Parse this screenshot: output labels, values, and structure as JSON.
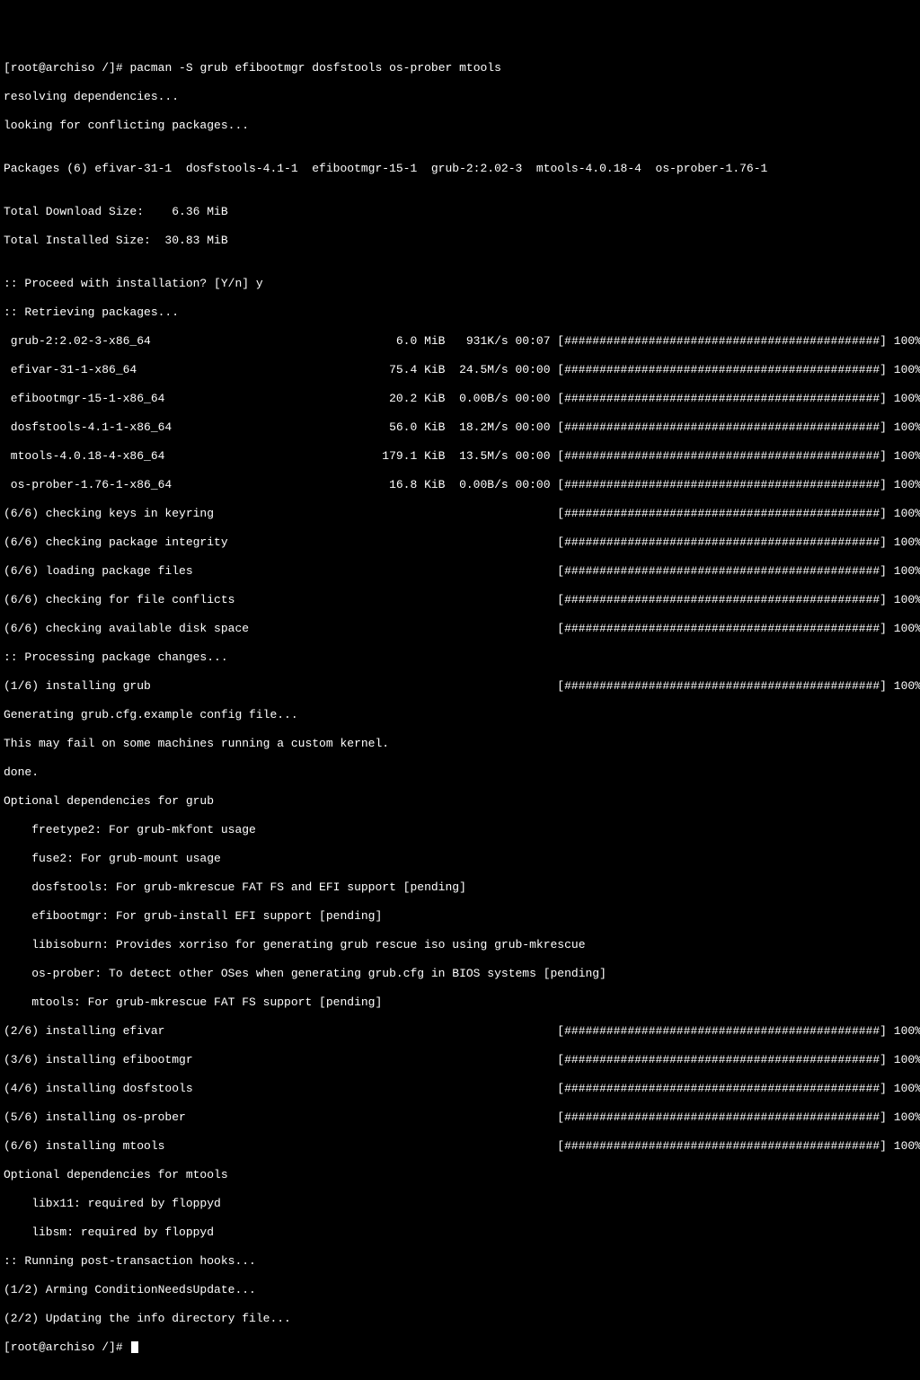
{
  "prompt": "[root@archiso /]# ",
  "command": "pacman -S grub efibootmgr dosfstools os-prober mtools",
  "lines": {
    "l1": "resolving dependencies...",
    "l2": "looking for conflicting packages...",
    "l3": "",
    "l4": "Packages (6) efivar-31-1  dosfstools-4.1-1  efibootmgr-15-1  grub-2:2.02-3  mtools-4.0.18-4  os-prober-1.76-1",
    "l5": "",
    "l6": "Total Download Size:    6.36 MiB",
    "l7": "Total Installed Size:  30.83 MiB",
    "l8": "",
    "l9": ":: Proceed with installation? [Y/n] y",
    "l10": ":: Retrieving packages...",
    "l11": " grub-2:2.02-3-x86_64                                   6.0 MiB   931K/s 00:07 [#############################################] 100%",
    "l12": " efivar-31-1-x86_64                                    75.4 KiB  24.5M/s 00:00 [#############################################] 100%",
    "l13": " efibootmgr-15-1-x86_64                                20.2 KiB  0.00B/s 00:00 [#############################################] 100%",
    "l14": " dosfstools-4.1-1-x86_64                               56.0 KiB  18.2M/s 00:00 [#############################################] 100%",
    "l15": " mtools-4.0.18-4-x86_64                               179.1 KiB  13.5M/s 00:00 [#############################################] 100%",
    "l16": " os-prober-1.76-1-x86_64                               16.8 KiB  0.00B/s 00:00 [#############################################] 100%",
    "l17": "(6/6) checking keys in keyring                                                 [#############################################] 100%",
    "l18": "(6/6) checking package integrity                                               [#############################################] 100%",
    "l19": "(6/6) loading package files                                                    [#############################################] 100%",
    "l20": "(6/6) checking for file conflicts                                              [#############################################] 100%",
    "l21": "(6/6) checking available disk space                                            [#############################################] 100%",
    "l22": ":: Processing package changes...",
    "l23": "(1/6) installing grub                                                          [#############################################] 100%",
    "l24": "Generating grub.cfg.example config file...",
    "l25": "This may fail on some machines running a custom kernel.",
    "l26": "done.",
    "l27": "Optional dependencies for grub",
    "l28": "    freetype2: For grub-mkfont usage",
    "l29": "    fuse2: For grub-mount usage",
    "l30": "    dosfstools: For grub-mkrescue FAT FS and EFI support [pending]",
    "l31": "    efibootmgr: For grub-install EFI support [pending]",
    "l32": "    libisoburn: Provides xorriso for generating grub rescue iso using grub-mkrescue",
    "l33": "    os-prober: To detect other OSes when generating grub.cfg in BIOS systems [pending]",
    "l34": "    mtools: For grub-mkrescue FAT FS support [pending]",
    "l35": "(2/6) installing efivar                                                        [#############################################] 100%",
    "l36": "(3/6) installing efibootmgr                                                    [#############################################] 100%",
    "l37": "(4/6) installing dosfstools                                                    [#############################################] 100%",
    "l38": "(5/6) installing os-prober                                                     [#############################################] 100%",
    "l39": "(6/6) installing mtools                                                        [#############################################] 100%",
    "l40": "Optional dependencies for mtools",
    "l41": "    libx11: required by floppyd",
    "l42": "    libsm: required by floppyd",
    "l43": ":: Running post-transaction hooks...",
    "l44": "(1/2) Arming ConditionNeedsUpdate...",
    "l45": "(2/2) Updating the info directory file...",
    "l46": "[root@archiso /]# "
  }
}
